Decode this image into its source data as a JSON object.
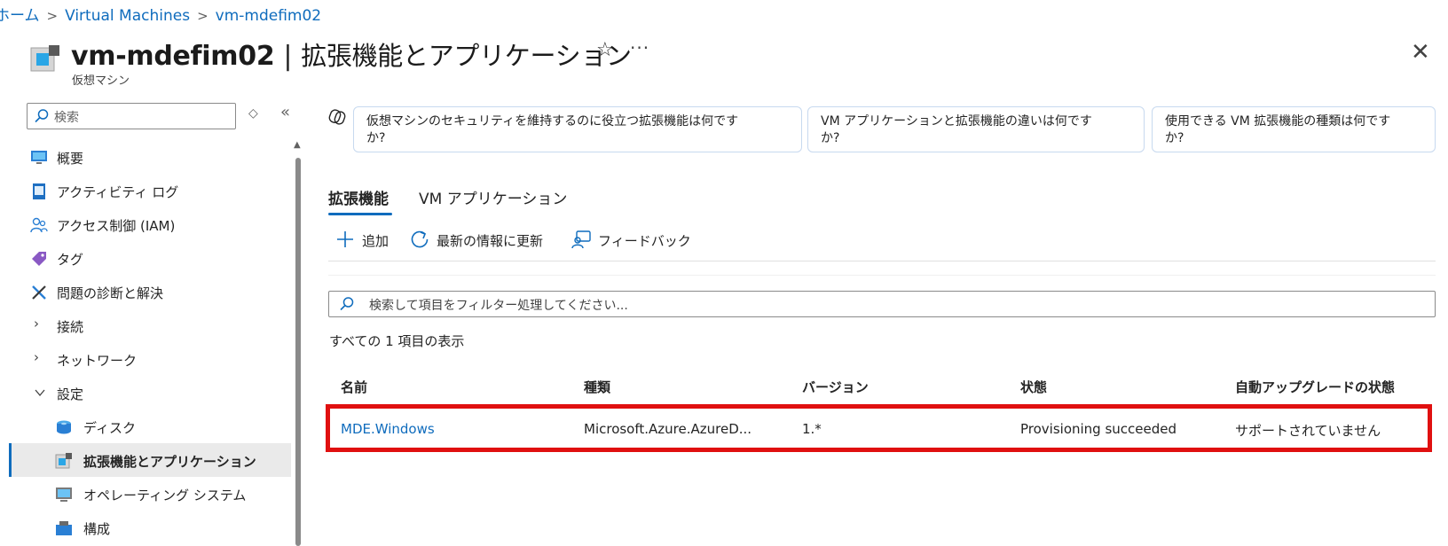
{
  "breadcrumb": {
    "home": "ホーム",
    "sep": ">",
    "level1": "Virtual Machines",
    "level2": "vm-mdefim02"
  },
  "header": {
    "vm_name": "vm-mdefim02",
    "pipe": "|",
    "page_title": "拡張機能とアプリケーション",
    "subtitle": "仮想マシン",
    "star": "☆",
    "more": "···",
    "close": "✕"
  },
  "sidebar": {
    "search_placeholder": "検索",
    "sort_glyph": "◇",
    "collapse_glyph": "«",
    "items": [
      {
        "label": "概要",
        "icon": "monitor-icon"
      },
      {
        "label": "アクティビティ ログ",
        "icon": "log-icon"
      },
      {
        "label": "アクセス制御 (IAM)",
        "icon": "people-icon"
      },
      {
        "label": "タグ",
        "icon": "tag-icon"
      },
      {
        "label": "問題の診断と解決",
        "icon": "wrench-icon"
      },
      {
        "label": "接続",
        "icon": "chevron-right-icon"
      },
      {
        "label": "ネットワーク",
        "icon": "chevron-right-icon"
      },
      {
        "label": "設定",
        "icon": "chevron-down-icon"
      },
      {
        "label": "ディスク",
        "icon": "disk-icon"
      },
      {
        "label": "拡張機能とアプリケーション",
        "icon": "extensions-icon"
      },
      {
        "label": "オペレーティング システム",
        "icon": "os-icon"
      },
      {
        "label": "構成",
        "icon": "config-icon"
      }
    ]
  },
  "copilot": {
    "chips": [
      "仮想マシンのセキュリティを維持するのに役立つ拡張機能は何です\nか?",
      "VM アプリケーションと拡張機能の違いは何です\nか?",
      "使用できる VM 拡張機能の種類は何です\nか?"
    ]
  },
  "tabs": [
    {
      "label": "拡張機能"
    },
    {
      "label": "VM アプリケーション"
    }
  ],
  "toolbar": {
    "add": "追加",
    "refresh": "最新の情報に更新",
    "feedback": "フィードバック"
  },
  "filter": {
    "placeholder": "検索して項目をフィルター処理してください..."
  },
  "count_text": "すべての 1 項目の表示",
  "table": {
    "columns": [
      "名前",
      "種類",
      "バージョン",
      "状態",
      "自動アップグレードの状態"
    ],
    "rows": [
      [
        "MDE.Windows",
        "Microsoft.Azure.AzureD...",
        "1.*",
        "Provisioning succeeded",
        "サポートされていません"
      ]
    ]
  },
  "colors": {
    "accent": "#0f6cbd",
    "highlight": "#e01010"
  }
}
